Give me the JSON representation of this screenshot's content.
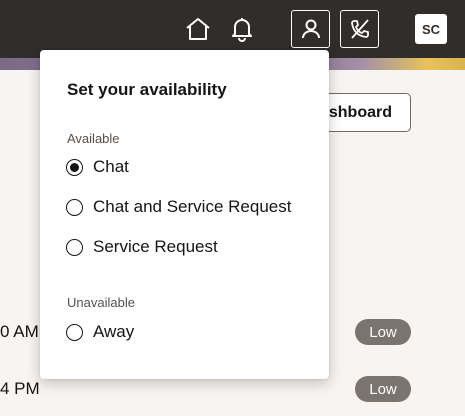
{
  "header": {
    "icons": [
      "home-icon",
      "bell-icon",
      "user-icon",
      "phone-off-icon"
    ],
    "avatar_initials": "SC",
    "bar_color": "#312d2a"
  },
  "background": {
    "dashboard_button_label": "ashboard",
    "rows": [
      {
        "time": "0 AM",
        "priority": "Low"
      },
      {
        "time": "4 PM",
        "priority": "Low"
      }
    ]
  },
  "availability": {
    "title": "Set your availability",
    "available_label": "Available",
    "unavailable_label": "Unavailable",
    "options": [
      {
        "label": "Chat",
        "selected": true
      },
      {
        "label": "Chat and Service Request",
        "selected": false
      },
      {
        "label": "Service Request",
        "selected": false
      },
      {
        "label": "Away",
        "selected": false
      }
    ]
  }
}
